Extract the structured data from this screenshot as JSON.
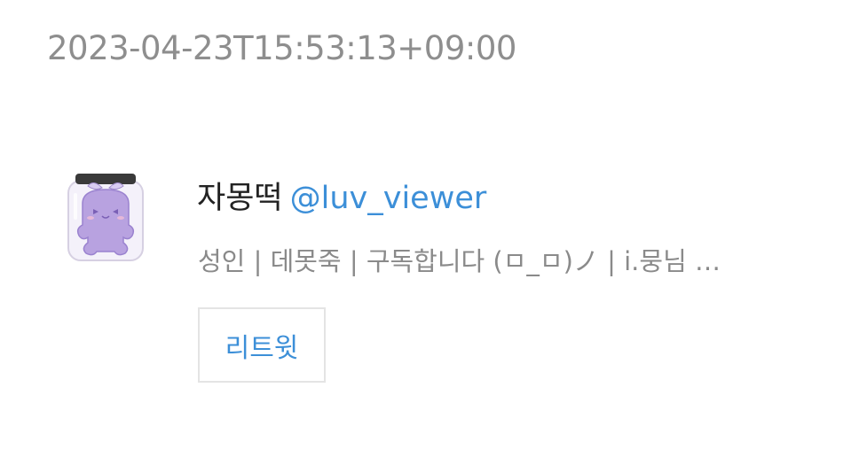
{
  "timestamp": "2023-04-23T15:53:13+09:00",
  "user": {
    "display_name": "자몽떡",
    "handle": "@luv_viewer",
    "bio": "성인 | 데못죽 | 구독합니다 (ㅁ_ㅁ)ノ | i.뭉님 …"
  },
  "actions": {
    "retweet_label": "리트윗"
  },
  "colors": {
    "handle": "#3c8fd8",
    "muted_text": "#8a8a8a",
    "avatar_body": "#b8a2e0"
  },
  "icons": {
    "avatar": "purple-jar-creature-icon"
  }
}
